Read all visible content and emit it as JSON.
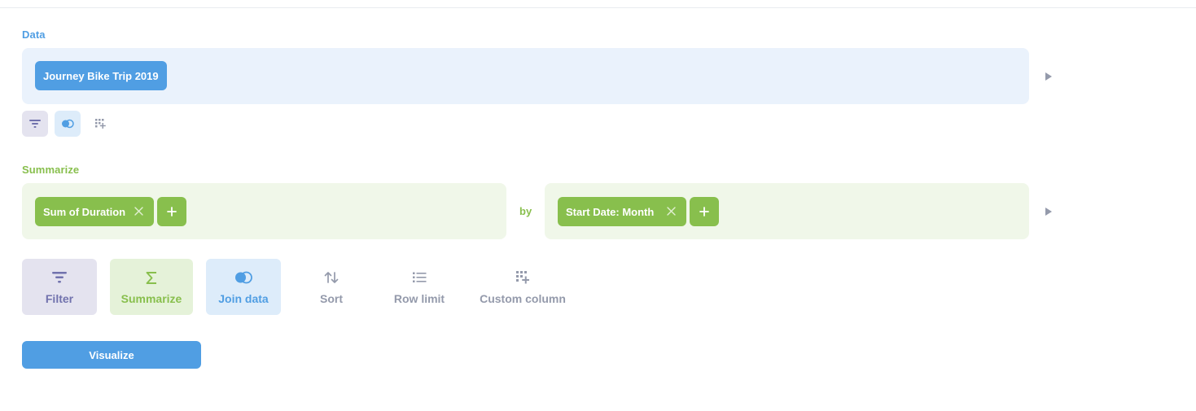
{
  "sections": {
    "data_label": "Data",
    "summarize_label": "Summarize"
  },
  "data_step": {
    "table_name": "Journey Bike Trip 2019"
  },
  "summarize_step": {
    "metric": "Sum of Duration",
    "by_label": "by",
    "breakout": "Start Date: Month"
  },
  "actions": {
    "filter": "Filter",
    "summarize": "Summarize",
    "join": "Join data",
    "sort": "Sort",
    "row_limit": "Row limit",
    "custom_column": "Custom column"
  },
  "visualize_label": "Visualize",
  "colors": {
    "brand_blue": "#509ee3",
    "summarize_green": "#88bf4d",
    "filter_purple": "#7172ad",
    "muted_gray": "#949aab",
    "data_panel_bg": "#eaf2fc",
    "summarize_panel_bg": "#f0f7e9"
  },
  "icons": {
    "filter": "filter-icon",
    "summarize": "sigma-icon",
    "join": "join-icon",
    "sort": "sort-arrows-icon",
    "row_limit": "list-icon",
    "custom_column": "grid-plus-icon",
    "expand": "play-triangle-icon",
    "remove": "close-icon",
    "add": "plus-icon"
  }
}
